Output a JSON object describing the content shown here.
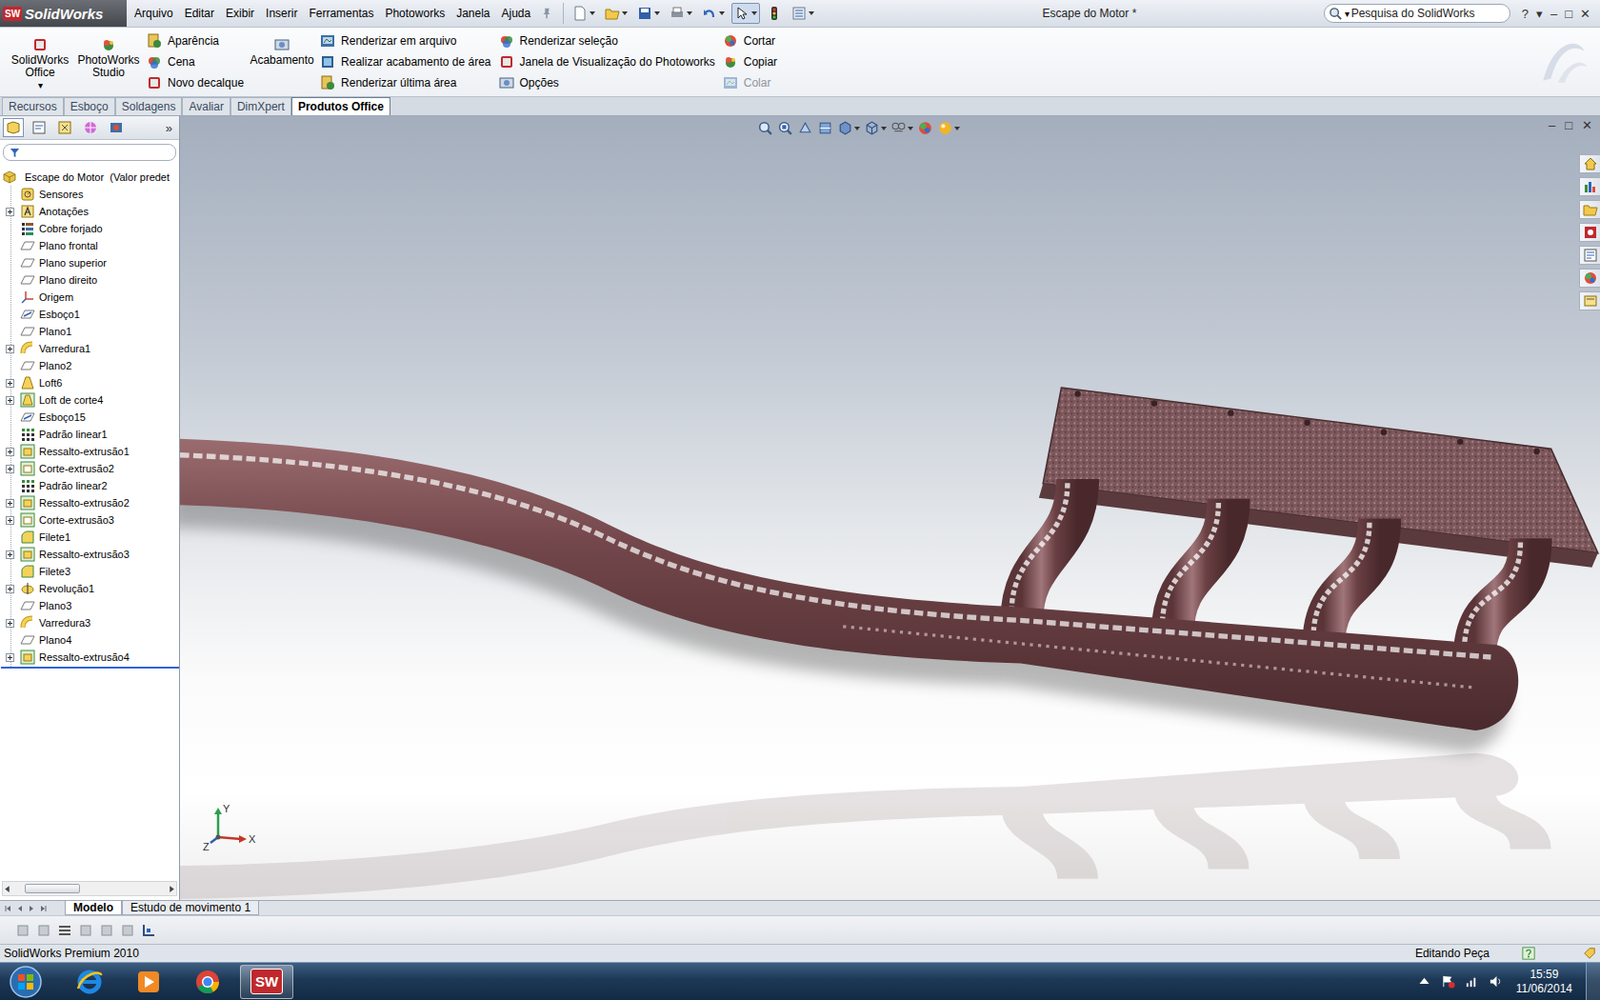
{
  "app": {
    "logo": "SolidWorks",
    "logo_mark": "SW",
    "title": "Escape do Motor *"
  },
  "menu": [
    "Arquivo",
    "Editar",
    "Exibir",
    "Inserir",
    "Ferramentas",
    "Photoworks",
    "Janela",
    "Ajuda"
  ],
  "search": {
    "placeholder": "Pesquisa do SolidWorks",
    "arrow": "▾"
  },
  "window_controls": [
    "?",
    "▾",
    "–",
    "□",
    "✕"
  ],
  "dropdown_glyph": "▾",
  "ribbon": [
    {
      "kind": "large",
      "items": [
        {
          "label": "SolidWorks Office",
          "disabled": false,
          "dropdown": true
        }
      ]
    },
    {
      "kind": "large",
      "items": [
        {
          "label": "PhotoWorks Studio",
          "disabled": false,
          "dropdown": false
        }
      ]
    },
    {
      "kind": "stack",
      "items": [
        {
          "label": "Aparência",
          "disabled": false,
          "dropdown": false
        },
        {
          "label": "Cena",
          "disabled": false,
          "dropdown": false
        },
        {
          "label": "Novo decalque",
          "disabled": false,
          "dropdown": false
        }
      ]
    },
    {
      "kind": "large",
      "items": [
        {
          "label": "Acabamento",
          "disabled": false,
          "dropdown": false
        }
      ]
    },
    {
      "kind": "stack",
      "items": [
        {
          "label": "Renderizar em arquivo",
          "disabled": false,
          "dropdown": false
        },
        {
          "label": "Realizar acabamento de área",
          "disabled": false,
          "dropdown": false
        },
        {
          "label": "Renderizar última área",
          "disabled": false,
          "dropdown": false
        }
      ]
    },
    {
      "kind": "stack",
      "items": [
        {
          "label": "Renderizar seleção",
          "disabled": false,
          "dropdown": false
        },
        {
          "label": "Janela de Visualização do Photoworks",
          "disabled": false,
          "dropdown": false
        },
        {
          "label": "Opções",
          "disabled": false,
          "dropdown": false
        }
      ]
    },
    {
      "kind": "stack",
      "items": [
        {
          "label": "Cortar",
          "disabled": false,
          "dropdown": false
        },
        {
          "label": "Copiar",
          "disabled": false,
          "dropdown": false
        },
        {
          "label": "Colar",
          "disabled": true,
          "dropdown": false
        }
      ]
    }
  ],
  "command_tabs": [
    {
      "label": "Recursos",
      "selected": false
    },
    {
      "label": "Esboço",
      "selected": false
    },
    {
      "label": "Soldagens",
      "selected": false
    },
    {
      "label": "Avaliar",
      "selected": false
    },
    {
      "label": "DimXpert",
      "selected": false
    },
    {
      "label": "Produtos Office",
      "selected": true
    }
  ],
  "feature_tree": {
    "more": "»",
    "root": {
      "label": "Escape do Motor  (Valor predet",
      "kind": "part"
    },
    "items": [
      {
        "label": "Sensores",
        "kind": "sensor",
        "expandable": false
      },
      {
        "label": "Anotações",
        "kind": "annotation",
        "expandable": true
      },
      {
        "label": "Cobre forjado",
        "kind": "material",
        "expandable": false
      },
      {
        "label": "Plano frontal",
        "kind": "plane",
        "expandable": false
      },
      {
        "label": "Plano superior",
        "kind": "plane",
        "expandable": false
      },
      {
        "label": "Plano direito",
        "kind": "plane",
        "expandable": false
      },
      {
        "label": "Origem",
        "kind": "origin",
        "expandable": false
      },
      {
        "label": "Esboço1",
        "kind": "sketch",
        "expandable": false
      },
      {
        "label": "Plano1",
        "kind": "plane",
        "expandable": false
      },
      {
        "label": "Varredura1",
        "kind": "sweep",
        "expandable": true
      },
      {
        "label": "Plano2",
        "kind": "plane",
        "expandable": false
      },
      {
        "label": "Loft6",
        "kind": "loft",
        "expandable": true
      },
      {
        "label": "Loft de corte4",
        "kind": "cut-loft",
        "expandable": true
      },
      {
        "label": "Esboço15",
        "kind": "sketch",
        "expandable": false
      },
      {
        "label": "Padrão linear1",
        "kind": "pattern",
        "expandable": false
      },
      {
        "label": "Ressalto-extrusão1",
        "kind": "boss",
        "expandable": true
      },
      {
        "label": "Corte-extrusão2",
        "kind": "cut",
        "expandable": true
      },
      {
        "label": "Padrão linear2",
        "kind": "pattern",
        "expandable": false
      },
      {
        "label": "Ressalto-extrusão2",
        "kind": "boss",
        "expandable": true
      },
      {
        "label": "Corte-extrusão3",
        "kind": "cut",
        "expandable": true
      },
      {
        "label": "Filete1",
        "kind": "fillet",
        "expandable": false
      },
      {
        "label": "Ressalto-extrusão3",
        "kind": "boss",
        "expandable": true
      },
      {
        "label": "Filete3",
        "kind": "fillet",
        "expandable": false
      },
      {
        "label": "Revolução1",
        "kind": "revolve",
        "expandable": true
      },
      {
        "label": "Plano3",
        "kind": "plane",
        "expandable": false
      },
      {
        "label": "Varredura3",
        "kind": "sweep",
        "expandable": true
      },
      {
        "label": "Plano4",
        "kind": "plane",
        "expandable": false
      },
      {
        "label": "Ressalto-extrusão4",
        "kind": "boss",
        "expandable": true
      }
    ]
  },
  "viewport": {
    "window_controls": [
      "–",
      "□",
      "✕"
    ],
    "axes": {
      "y": "Y",
      "x": "X",
      "z": "Z"
    }
  },
  "bottom_tabs": [
    {
      "label": "Modelo",
      "selected": true
    },
    {
      "label": "Estudo de movimento 1",
      "selected": false
    }
  ],
  "status_bar": {
    "left": "SolidWorks Premium 2010",
    "mode": "Editando Peça"
  },
  "taskbar": {
    "apps": [
      {
        "kind": "ie",
        "active": false
      },
      {
        "kind": "media",
        "active": false
      },
      {
        "kind": "chrome",
        "active": false
      },
      {
        "kind": "solidworks",
        "active": true
      }
    ],
    "time": "15:59",
    "date": "11/06/2014"
  }
}
